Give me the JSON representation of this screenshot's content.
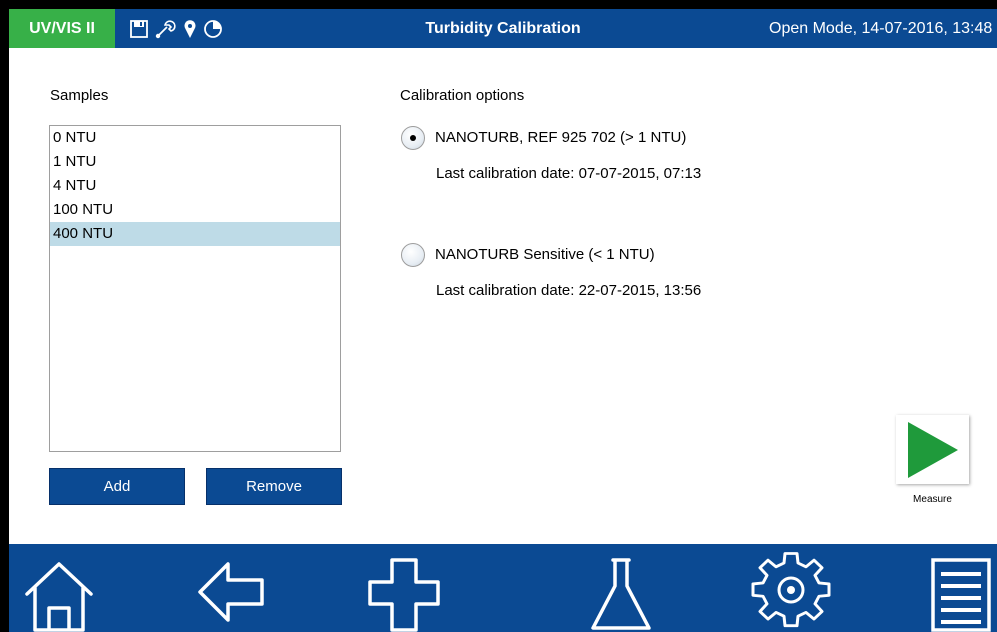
{
  "header": {
    "app_badge": "UV/VIS II",
    "icons": [
      "save-icon",
      "wrench-icon",
      "location-pin-icon",
      "pie-timer-icon"
    ],
    "title": "Turbidity Calibration",
    "status": "Open Mode, 14-07-2016, 13:48"
  },
  "samples": {
    "title": "Samples",
    "items": [
      {
        "label": "0 NTU",
        "selected": false
      },
      {
        "label": "1 NTU",
        "selected": false
      },
      {
        "label": "4 NTU",
        "selected": false
      },
      {
        "label": "100 NTU",
        "selected": false
      },
      {
        "label": "400 NTU",
        "selected": true
      }
    ],
    "add_label": "Add",
    "remove_label": "Remove"
  },
  "calibration": {
    "title": "Calibration options",
    "options": [
      {
        "label": "NANOTURB, REF 925 702 (> 1 NTU)",
        "date": "Last calibration date: 07-07-2015, 07:13",
        "selected": true
      },
      {
        "label": "NANOTURB Sensitive (< 1 NTU)",
        "date": "Last calibration date: 22-07-2015, 13:56",
        "selected": false
      }
    ]
  },
  "measure": {
    "label": "Measure",
    "icon": "play-icon"
  },
  "nav": {
    "icons": [
      "home-icon",
      "back-arrow-icon",
      "plus-icon",
      "flask-icon",
      "settings-gear-icon",
      "menu-list-icon"
    ]
  },
  "colors": {
    "header_blue": "#0b4a93",
    "badge_green": "#37b048",
    "selection": "#bedbe7",
    "play_green": "#1f9a3b"
  }
}
